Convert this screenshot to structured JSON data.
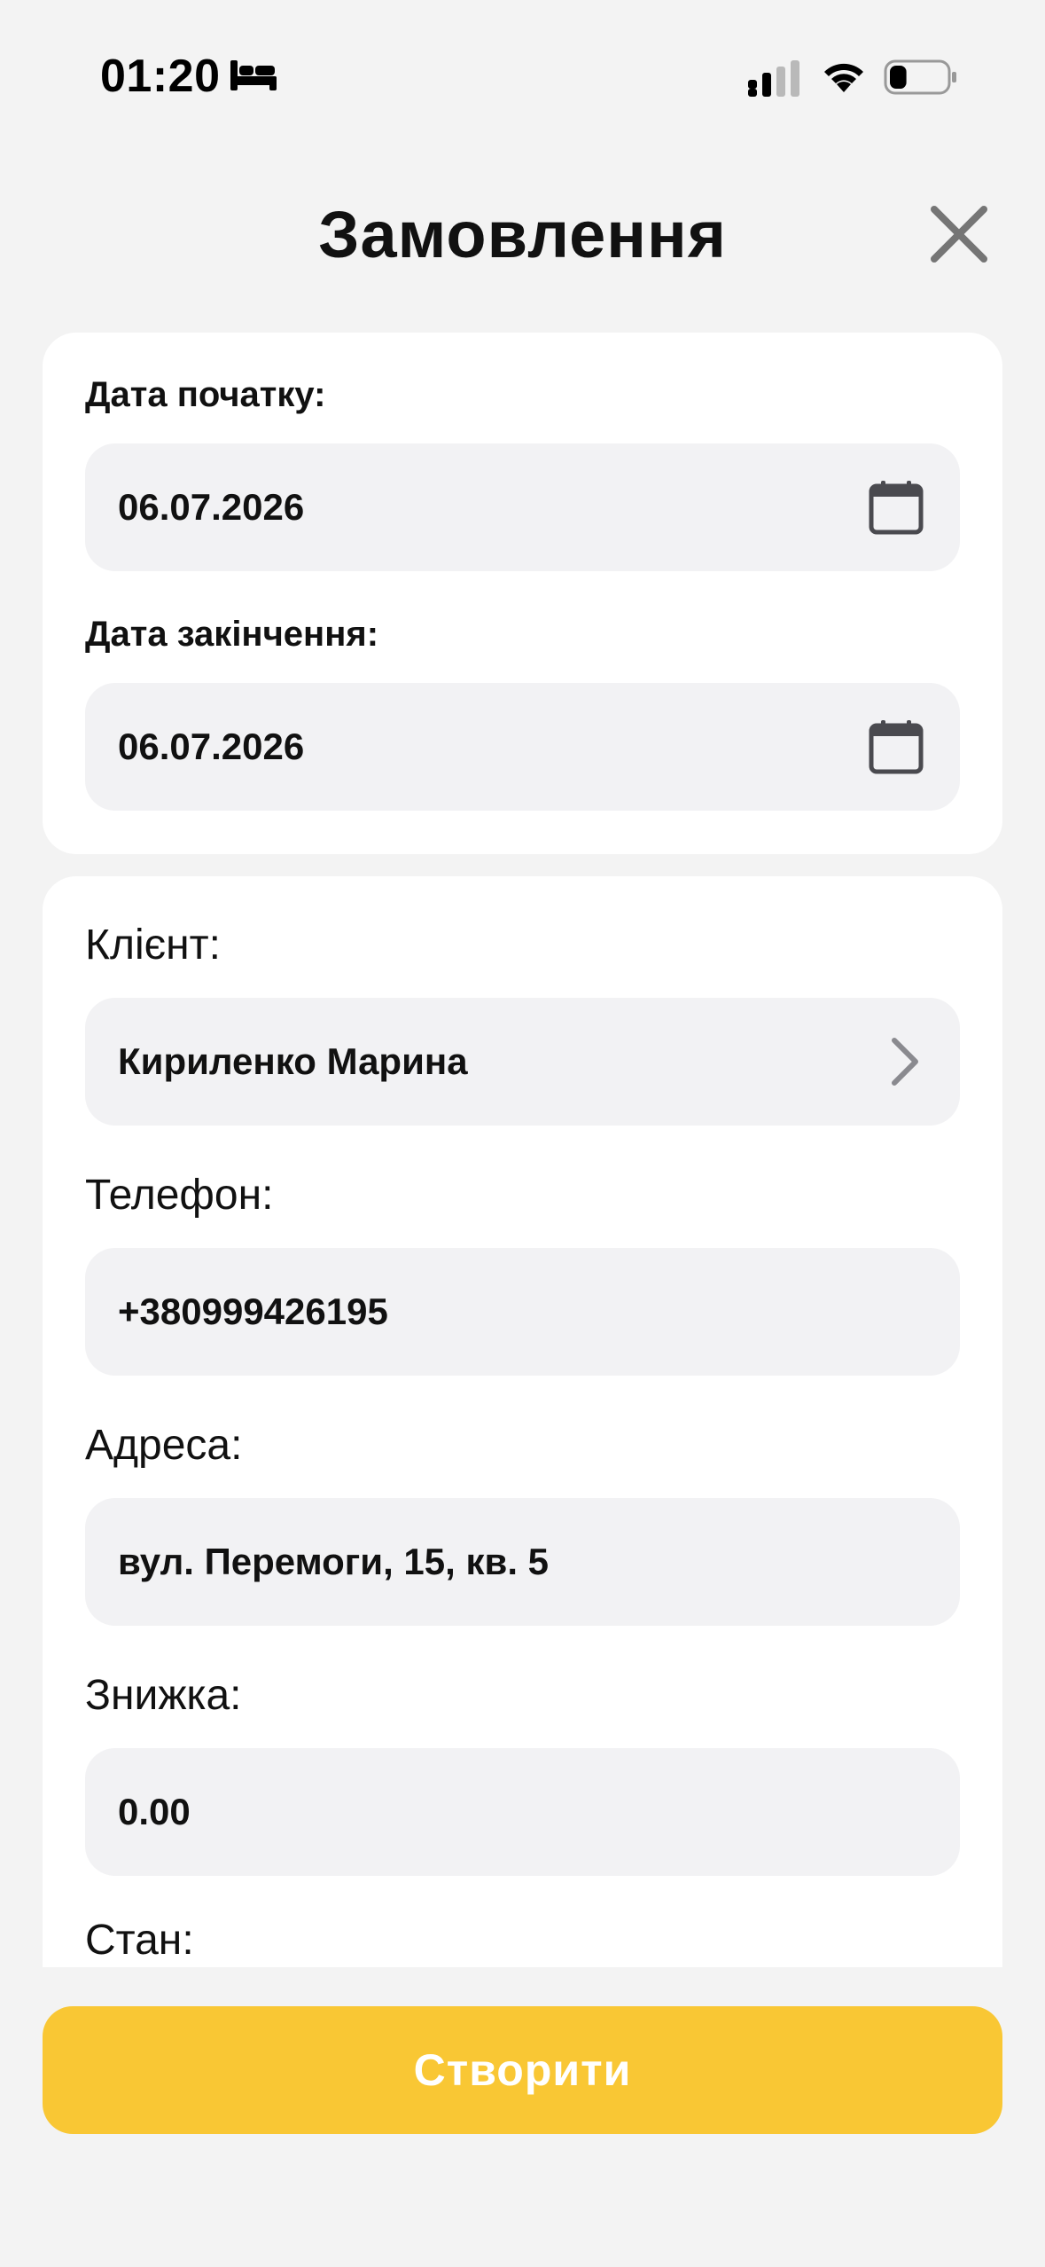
{
  "status_bar": {
    "time": "01:20",
    "focus_icon": "bed-icon",
    "signal_icon": "cellular-signal-icon",
    "wifi_icon": "wifi-icon",
    "battery_icon": "battery-icon",
    "battery_level": 0.3
  },
  "header": {
    "title": "Замовлення",
    "close_icon": "close-icon"
  },
  "dates": {
    "start_label": "Дата початку:",
    "start_value": "06.07.2026",
    "end_label": "Дата закінчення:",
    "end_value": "06.07.2026",
    "calendar_icon": "calendar-icon"
  },
  "client_section": {
    "client_label": "Клієнт:",
    "client_value": "Кириленко Марина",
    "phone_label": "Телефон:",
    "phone_value": "+380999426195",
    "address_label": "Адреса:",
    "address_value": "вул. Перемоги, 15, кв. 5",
    "discount_label": "Знижка:",
    "discount_value": "0.00",
    "state_label": "Стан:"
  },
  "actions": {
    "create_label": "Створити"
  },
  "colors": {
    "background": "#f3f3f3",
    "card": "#ffffff",
    "field": "#f2f2f4",
    "accent": "#f9c734",
    "icon_gray": "#4a4a4f"
  }
}
